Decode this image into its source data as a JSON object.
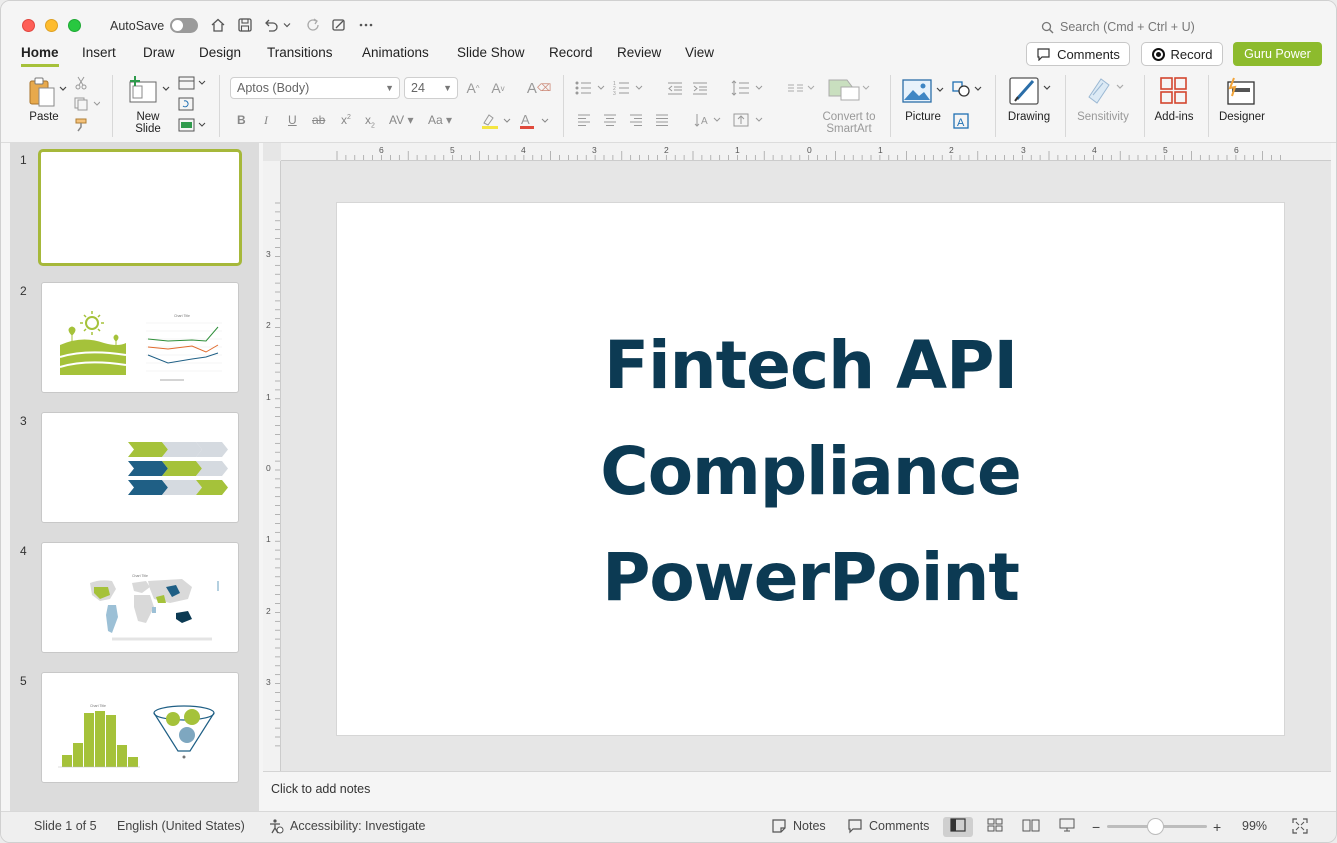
{
  "titlebar": {
    "autosave_label": "AutoSave",
    "search_placeholder": "Search (Cmd + Ctrl + U)"
  },
  "tabs": [
    {
      "label": "Home",
      "active": true
    },
    {
      "label": "Insert"
    },
    {
      "label": "Draw"
    },
    {
      "label": "Design"
    },
    {
      "label": "Transitions"
    },
    {
      "label": "Animations"
    },
    {
      "label": "Slide Show"
    },
    {
      "label": "Record"
    },
    {
      "label": "Review"
    },
    {
      "label": "View"
    }
  ],
  "header_buttons": {
    "comments": "Comments",
    "record": "Record",
    "guru": "Guru Power"
  },
  "ribbon": {
    "paste": "Paste",
    "new_slide_1": "New",
    "new_slide_2": "Slide",
    "font_name": "Aptos (Body)",
    "font_size": "24",
    "convert_1": "Convert to",
    "convert_2": "SmartArt",
    "picture": "Picture",
    "drawing": "Drawing",
    "sensitivity": "Sensitivity",
    "addins": "Add-ins",
    "designer": "Designer"
  },
  "slides": [
    {
      "number": "1"
    },
    {
      "number": "2",
      "mini_title": "Chart Title"
    },
    {
      "number": "3"
    },
    {
      "number": "4",
      "mini_title": "Chart Title"
    },
    {
      "number": "5",
      "mini_title": "Chart Title"
    }
  ],
  "rulers": {
    "horizontal": [
      "6",
      "5",
      "4",
      "3",
      "2",
      "1",
      "0",
      "1",
      "2",
      "3",
      "4",
      "5",
      "6"
    ],
    "vertical": [
      "3",
      "2",
      "1",
      "0",
      "1",
      "2",
      "3"
    ]
  },
  "slide": {
    "title_line1": "Fintech API",
    "title_line2": "Compliance",
    "title_line3": "PowerPoint",
    "title_color": "#0c3a53"
  },
  "notes": {
    "placeholder": "Click to add notes"
  },
  "status": {
    "slide_count": "Slide 1 of 5",
    "language": "English (United States)",
    "accessibility": "Accessibility: Investigate",
    "notes": "Notes",
    "comments": "Comments",
    "zoom": "99%"
  },
  "colors": {
    "accent": "#a6c13a",
    "guru_button": "#8dbb2d",
    "dark_blue": "#0c3a53",
    "mid_blue": "#1f5f85"
  }
}
